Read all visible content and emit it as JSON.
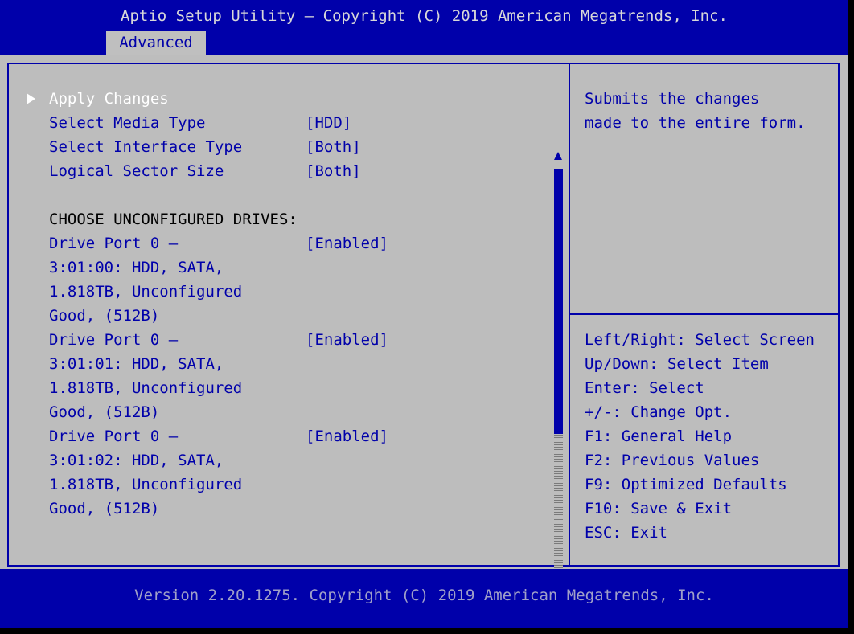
{
  "header": {
    "title": "Aptio Setup Utility – Copyright (C) 2019 American Megatrends, Inc.",
    "active_tab": "Advanced"
  },
  "menu": {
    "apply_changes": "Apply Changes",
    "media_type": {
      "label": "Select Media Type",
      "value": "[HDD]"
    },
    "interface_type": {
      "label": "Select Interface Type",
      "value": "[Both]"
    },
    "sector_size": {
      "label": "Logical Sector Size",
      "value": "[Both]"
    },
    "section_heading": "CHOOSE UNCONFIGURED DRIVES:",
    "drives": [
      {
        "label": "Drive Port 0 –",
        "value": "[Enabled]",
        "line2": "3:01:00: HDD, SATA,",
        "line3": "1.818TB, Unconfigured",
        "line4": "Good, (512B)"
      },
      {
        "label": "Drive Port 0 –",
        "value": "[Enabled]",
        "line2": "3:01:01: HDD, SATA,",
        "line3": "1.818TB, Unconfigured",
        "line4": "Good, (512B)"
      },
      {
        "label": "Drive Port 0 –",
        "value": "[Enabled]",
        "line2": "3:01:02: HDD, SATA,",
        "line3": "1.818TB, Unconfigured",
        "line4": "Good, (512B)"
      }
    ]
  },
  "help": {
    "description": [
      "Submits the changes",
      "made to the entire form."
    ],
    "keys": [
      "Left/Right: Select Screen",
      "Up/Down: Select Item",
      "Enter: Select",
      "+/-: Change Opt.",
      "F1: General Help",
      "F2: Previous Values",
      "F9: Optimized Defaults",
      "F10: Save & Exit",
      "ESC: Exit"
    ]
  },
  "footer": {
    "version": "Version 2.20.1275. Copyright (C) 2019 American Megatrends, Inc."
  },
  "colors": {
    "header_bg": "#0000aa",
    "panel_bg": "#bdbdbd",
    "text_blue": "#0000aa",
    "highlight": "#ffffff"
  }
}
